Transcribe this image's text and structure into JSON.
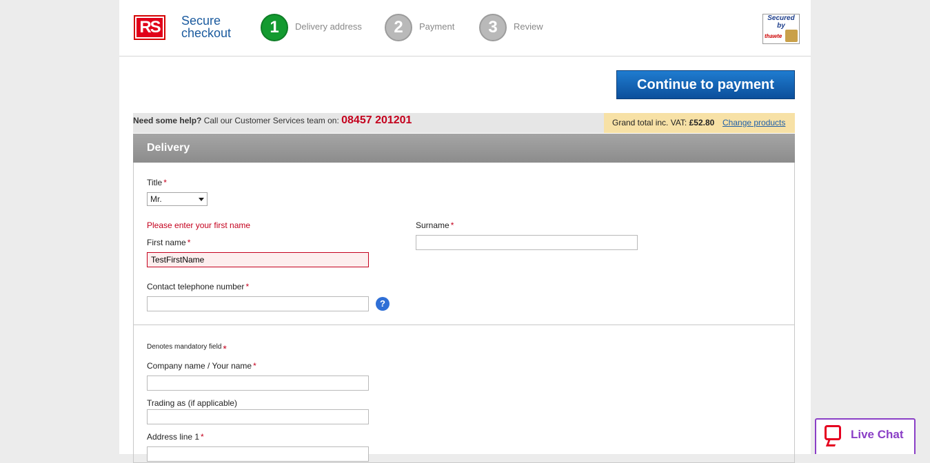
{
  "header": {
    "logo_text": "RS",
    "brand_line1": "Secure",
    "brand_line2": "checkout",
    "steps": [
      {
        "number": "1",
        "label": "Delivery address"
      },
      {
        "number": "2",
        "label": "Payment"
      },
      {
        "number": "3",
        "label": "Review"
      }
    ],
    "secured_line1": "Secured",
    "secured_line2": "by",
    "secured_brand": "thawte"
  },
  "actions": {
    "continue_label": "Continue to payment"
  },
  "help_bar": {
    "need_help": "Need some help?",
    "call_text": "Call our Customer Services team on:",
    "phone": "08457 201201",
    "grand_total_label": "Grand total inc. VAT:",
    "grand_total_value": "£52.80",
    "change_products": "Change products"
  },
  "delivery": {
    "heading": "Delivery",
    "title_label": "Title",
    "title_value": "Mr.",
    "first_name_error": "Please enter your first name",
    "first_name_label": "First name",
    "first_name_value": "TestFirstName",
    "surname_label": "Surname",
    "surname_value": "",
    "phone_label": "Contact telephone number",
    "phone_value": "",
    "help_icon": "?",
    "mandatory_note": "Denotes mandatory  field",
    "company_label": "Company name / Your name",
    "company_value": "",
    "trading_label": "Trading as (if applicable)",
    "trading_value": "",
    "address1_label": "Address line 1",
    "address1_value": "",
    "required_mark": "*"
  },
  "live_chat": {
    "label": "Live Chat"
  }
}
